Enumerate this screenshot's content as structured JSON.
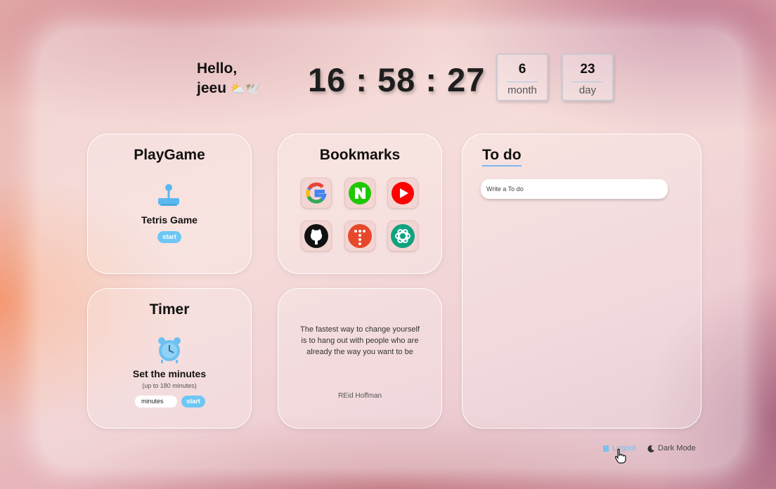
{
  "greeting": {
    "line1": "Hello,",
    "line2": "jeeu",
    "emoji": "⛅🕊️"
  },
  "clock": {
    "time": "16 : 58 : 27"
  },
  "date": {
    "month": {
      "value": "6",
      "label": "month"
    },
    "day": {
      "value": "23",
      "label": "day"
    }
  },
  "playgame": {
    "title": "PlayGame",
    "icon": "joystick-icon",
    "game_name": "Tetris Game",
    "start_label": "start"
  },
  "bookmarks": {
    "title": "Bookmarks",
    "items": [
      {
        "name": "google",
        "icon": "google-icon"
      },
      {
        "name": "naver",
        "icon": "naver-icon"
      },
      {
        "name": "youtube",
        "icon": "youtube-icon"
      },
      {
        "name": "github",
        "icon": "github-icon"
      },
      {
        "name": "t-app",
        "icon": "t-app-icon"
      },
      {
        "name": "chatgpt",
        "icon": "chatgpt-icon"
      }
    ]
  },
  "todo": {
    "title": "To do",
    "placeholder": "Write a To do"
  },
  "timer": {
    "title": "Timer",
    "icon": "alarm-clock-icon",
    "heading": "Set the minutes",
    "sub": "(up to 180 minutes)",
    "input_placeholder": "minutes",
    "start_label": "start"
  },
  "quote": {
    "text": "The fastest way to change yourself is to hang out with people who are already the way you want to be",
    "author": "REid Hoffman"
  },
  "footer": {
    "logout": "Logout",
    "darkmode": "Dark Mode"
  },
  "colors": {
    "accent": "#6ec7f3",
    "underline": "#7fb6ea"
  }
}
